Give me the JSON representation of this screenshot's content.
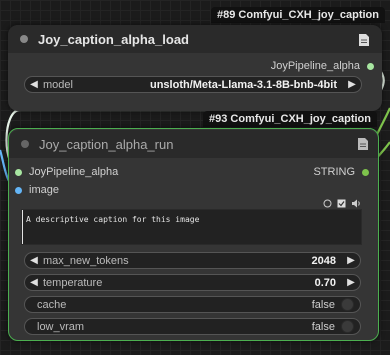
{
  "nodes": {
    "load": {
      "badge": "#89 Comfyui_CXH_joy_caption",
      "title": "Joy_caption_alpha_load",
      "output_label": "JoyPipeline_alpha",
      "model_widget": {
        "label": "model",
        "value": "unsloth/Meta-Llama-3.1-8B-bnb-4bit"
      }
    },
    "run": {
      "badge": "#93 Comfyui_CXH_joy_caption",
      "title": "Joy_caption_alpha_run",
      "input_pipeline": "JoyPipeline_alpha",
      "input_image": "image",
      "output_label": "STRING",
      "prompt_text": "A descriptive caption for this image",
      "widgets": {
        "max_new_tokens": {
          "label": "max_new_tokens",
          "value": "2048"
        },
        "temperature": {
          "label": "temperature",
          "value": "0.70"
        },
        "cache": {
          "label": "cache",
          "value": "false"
        },
        "low_vram": {
          "label": "low_vram",
          "value": "false"
        }
      }
    }
  },
  "colors": {
    "pipeline_link": "#a8e6a1",
    "string_link": "#7ec34c",
    "image_link": "#64b5f6",
    "selected_outline": "#4caf50"
  }
}
